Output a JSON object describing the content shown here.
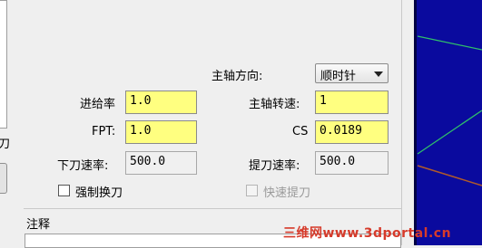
{
  "left_edge": {
    "clipped_char": "刀"
  },
  "spindle": {
    "direction_label": "主轴方向:",
    "direction_value": "顺时针",
    "speed_label": "主轴转速:",
    "speed_value": "1",
    "cs_label": "CS",
    "cs_value": "0.0189"
  },
  "feed": {
    "feed_rate_label": "进给率",
    "feed_rate_value": "1.0",
    "fpt_label": "FPT:",
    "fpt_value": "1.0",
    "plunge_rate_label": "下刀速率:",
    "plunge_rate_value": "500.0",
    "retract_rate_label": "提刀速率:",
    "retract_rate_value": "500.0"
  },
  "options": {
    "force_tool_change_label": "强制换刀",
    "force_tool_change_checked": false,
    "rapid_retract_label": "快速提刀",
    "rapid_retract_checked": false,
    "rapid_retract_enabled": false
  },
  "notes": {
    "label": "注释",
    "value": ""
  },
  "watermark": {
    "text": "三维网www.3dportal.cn"
  },
  "colors": {
    "input_highlight": "#ffff80",
    "viewport_background": "#0a0a9e",
    "viewport_line_green": "#2fbf6a",
    "viewport_line_brown": "#b05a2a",
    "watermark": "#d63a2a"
  }
}
